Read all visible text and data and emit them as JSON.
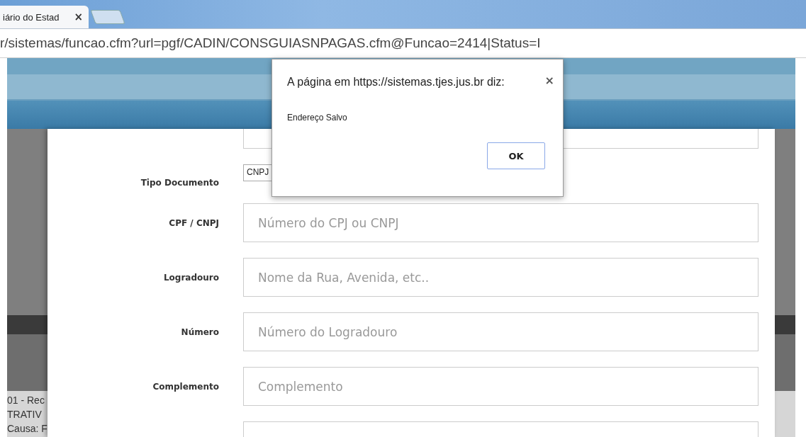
{
  "browser": {
    "tab": {
      "title": "iário do Estad",
      "close": "×"
    },
    "address": "r/sistemas/funcao.cfm?url=pgf/CADIN/CONSGUIASNPAGAS.cfm@Funcao=2414|Status=I"
  },
  "background_text": [
    "01 - Rec",
    "TRATIV",
    "Causa: F"
  ],
  "form": {
    "rows": [
      {
        "kind": "text"
      },
      {
        "kind": "select",
        "label": "Tipo Documento",
        "value": "CNPJ"
      },
      {
        "kind": "text",
        "label": "CPF / CNPJ",
        "placeholder": "Número do CPJ ou CNPJ"
      },
      {
        "kind": "text",
        "label": "Logradouro",
        "placeholder": "Nome da Rua, Avenida, etc.."
      },
      {
        "kind": "text",
        "label": "Número",
        "placeholder": "Número do Logradouro"
      },
      {
        "kind": "text",
        "label": "Complemento",
        "placeholder": "Complemento"
      },
      {
        "kind": "text"
      }
    ]
  },
  "dialog": {
    "title": "A página em https://sistemas.tjes.jus.br diz:",
    "close": "×",
    "message": "Endereço Salvo",
    "buttons": [
      "OK"
    ]
  }
}
